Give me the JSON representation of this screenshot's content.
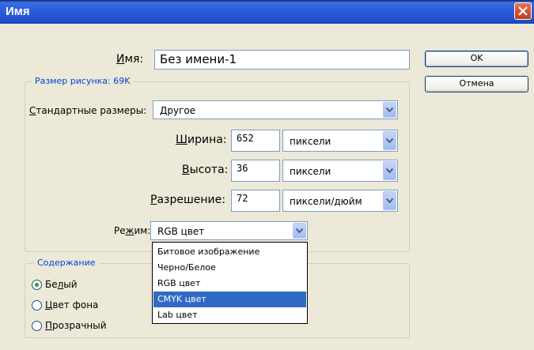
{
  "window": {
    "title": "Имя"
  },
  "name_field": {
    "label": "Имя:",
    "value": "Без имени-1"
  },
  "buttons": {
    "ok": "OK",
    "cancel": "Отмена"
  },
  "image_size_group": {
    "title": "Размер рисунка: 69K",
    "preset_label_u": "С",
    "preset_label_rest": "тандартные размеры:",
    "preset_value": "Другое",
    "width": {
      "label_u": "Ш",
      "label_rest": "ирина:",
      "value": "652",
      "unit": "пиксели"
    },
    "height": {
      "label_u": "В",
      "label_rest": "ысота:",
      "value": "36",
      "unit": "пиксели"
    },
    "resolution": {
      "label_u": "Р",
      "label_rest": "азрешение:",
      "value": "72",
      "unit": "пиксели/дюйм"
    },
    "mode": {
      "label_pre": "Ре",
      "label_u": "ж",
      "label_rest": "им:",
      "value": "RGB цвет"
    }
  },
  "mode_options": [
    "Битовое изображение",
    "Черно/Белое",
    "RGB цвет",
    "CMYK цвет",
    "Lab цвет"
  ],
  "mode_highlighted": "CMYK цвет",
  "contents_group": {
    "title": "Содержание",
    "options": [
      {
        "u": "",
        "pre": "Бе",
        "mid": "л",
        "rest": "ый",
        "checked": true
      },
      {
        "u": "Ц",
        "pre": "",
        "mid": "",
        "rest": "вет фона",
        "checked": false
      },
      {
        "u": "П",
        "pre": "",
        "mid": "",
        "rest": "розрачный",
        "checked": false
      }
    ]
  }
}
